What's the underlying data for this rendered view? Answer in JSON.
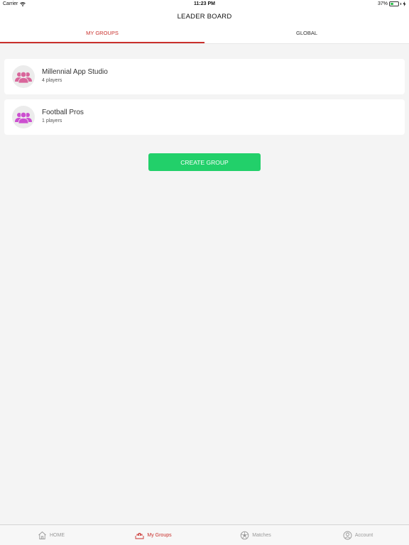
{
  "status_bar": {
    "carrier": "Carrier",
    "time": "11:23 PM",
    "battery": "37%",
    "battery_level": 0.37
  },
  "header": {
    "title": "LEADER BOARD"
  },
  "tabs": [
    {
      "label": "MY GROUPS",
      "active": true
    },
    {
      "label": "GLOBAL",
      "active": false
    }
  ],
  "groups": [
    {
      "name": "Millennial App Studio",
      "players": "4 players",
      "icon_color": "#d9669b"
    },
    {
      "name": "Football Pros",
      "players": "1 players",
      "icon_color": "#cc4fd0"
    }
  ],
  "actions": {
    "create_group": "CREATE GROUP"
  },
  "tab_bar": [
    {
      "label": "HOME",
      "icon": "home-icon"
    },
    {
      "label": "My Groups",
      "icon": "groups-icon",
      "active": true
    },
    {
      "label": "Matches",
      "icon": "soccer-ball-icon"
    },
    {
      "label": "Account",
      "icon": "account-icon"
    }
  ],
  "colors": {
    "accent": "#c9302c",
    "create_button": "#22d06a",
    "background": "#f4f4f4"
  }
}
